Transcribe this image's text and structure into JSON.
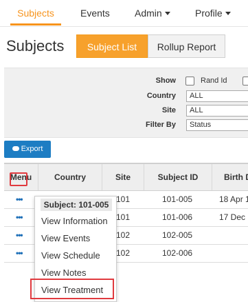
{
  "nav": {
    "items": [
      {
        "label": "Subjects",
        "active": true
      },
      {
        "label": "Events",
        "active": false
      },
      {
        "label": "Admin",
        "dropdown": true
      },
      {
        "label": "Profile",
        "dropdown": true
      }
    ],
    "accent_color": "#f7941d"
  },
  "page": {
    "title": "Subjects",
    "tabs": [
      {
        "label": "Subject List",
        "active": true
      },
      {
        "label": "Rollup Report",
        "active": false
      }
    ]
  },
  "filters": {
    "show_label": "Show",
    "rand_id_label": "Rand Id",
    "country_label": "Country",
    "country_value": "ALL",
    "site_label": "Site",
    "site_value": "ALL",
    "filter_by_label": "Filter By",
    "filter_by_value": "Status"
  },
  "export": {
    "label": "Export",
    "icon": "cloud-download-icon",
    "color": "#1d7dc3"
  },
  "table": {
    "headers": [
      "Menu",
      "Country",
      "Site",
      "Subject ID",
      "Birth D"
    ],
    "rows": [
      {
        "menu": "•••",
        "site": "101",
        "subject_id": "101-005",
        "birth": "18 Apr 1"
      },
      {
        "menu": "•••",
        "site": "101",
        "subject_id": "101-006",
        "birth": "17 Dec 1"
      },
      {
        "menu": "•••",
        "site": "102",
        "subject_id": "102-005",
        "birth": ""
      },
      {
        "menu": "•••",
        "site": "102",
        "subject_id": "102-006",
        "birth": ""
      }
    ]
  },
  "context_menu": {
    "header": "Subject: 101-005",
    "items": [
      "View Information",
      "View Events",
      "View Schedule",
      "View Notes",
      "View Treatment"
    ]
  },
  "highlight_color": "#e0393e"
}
